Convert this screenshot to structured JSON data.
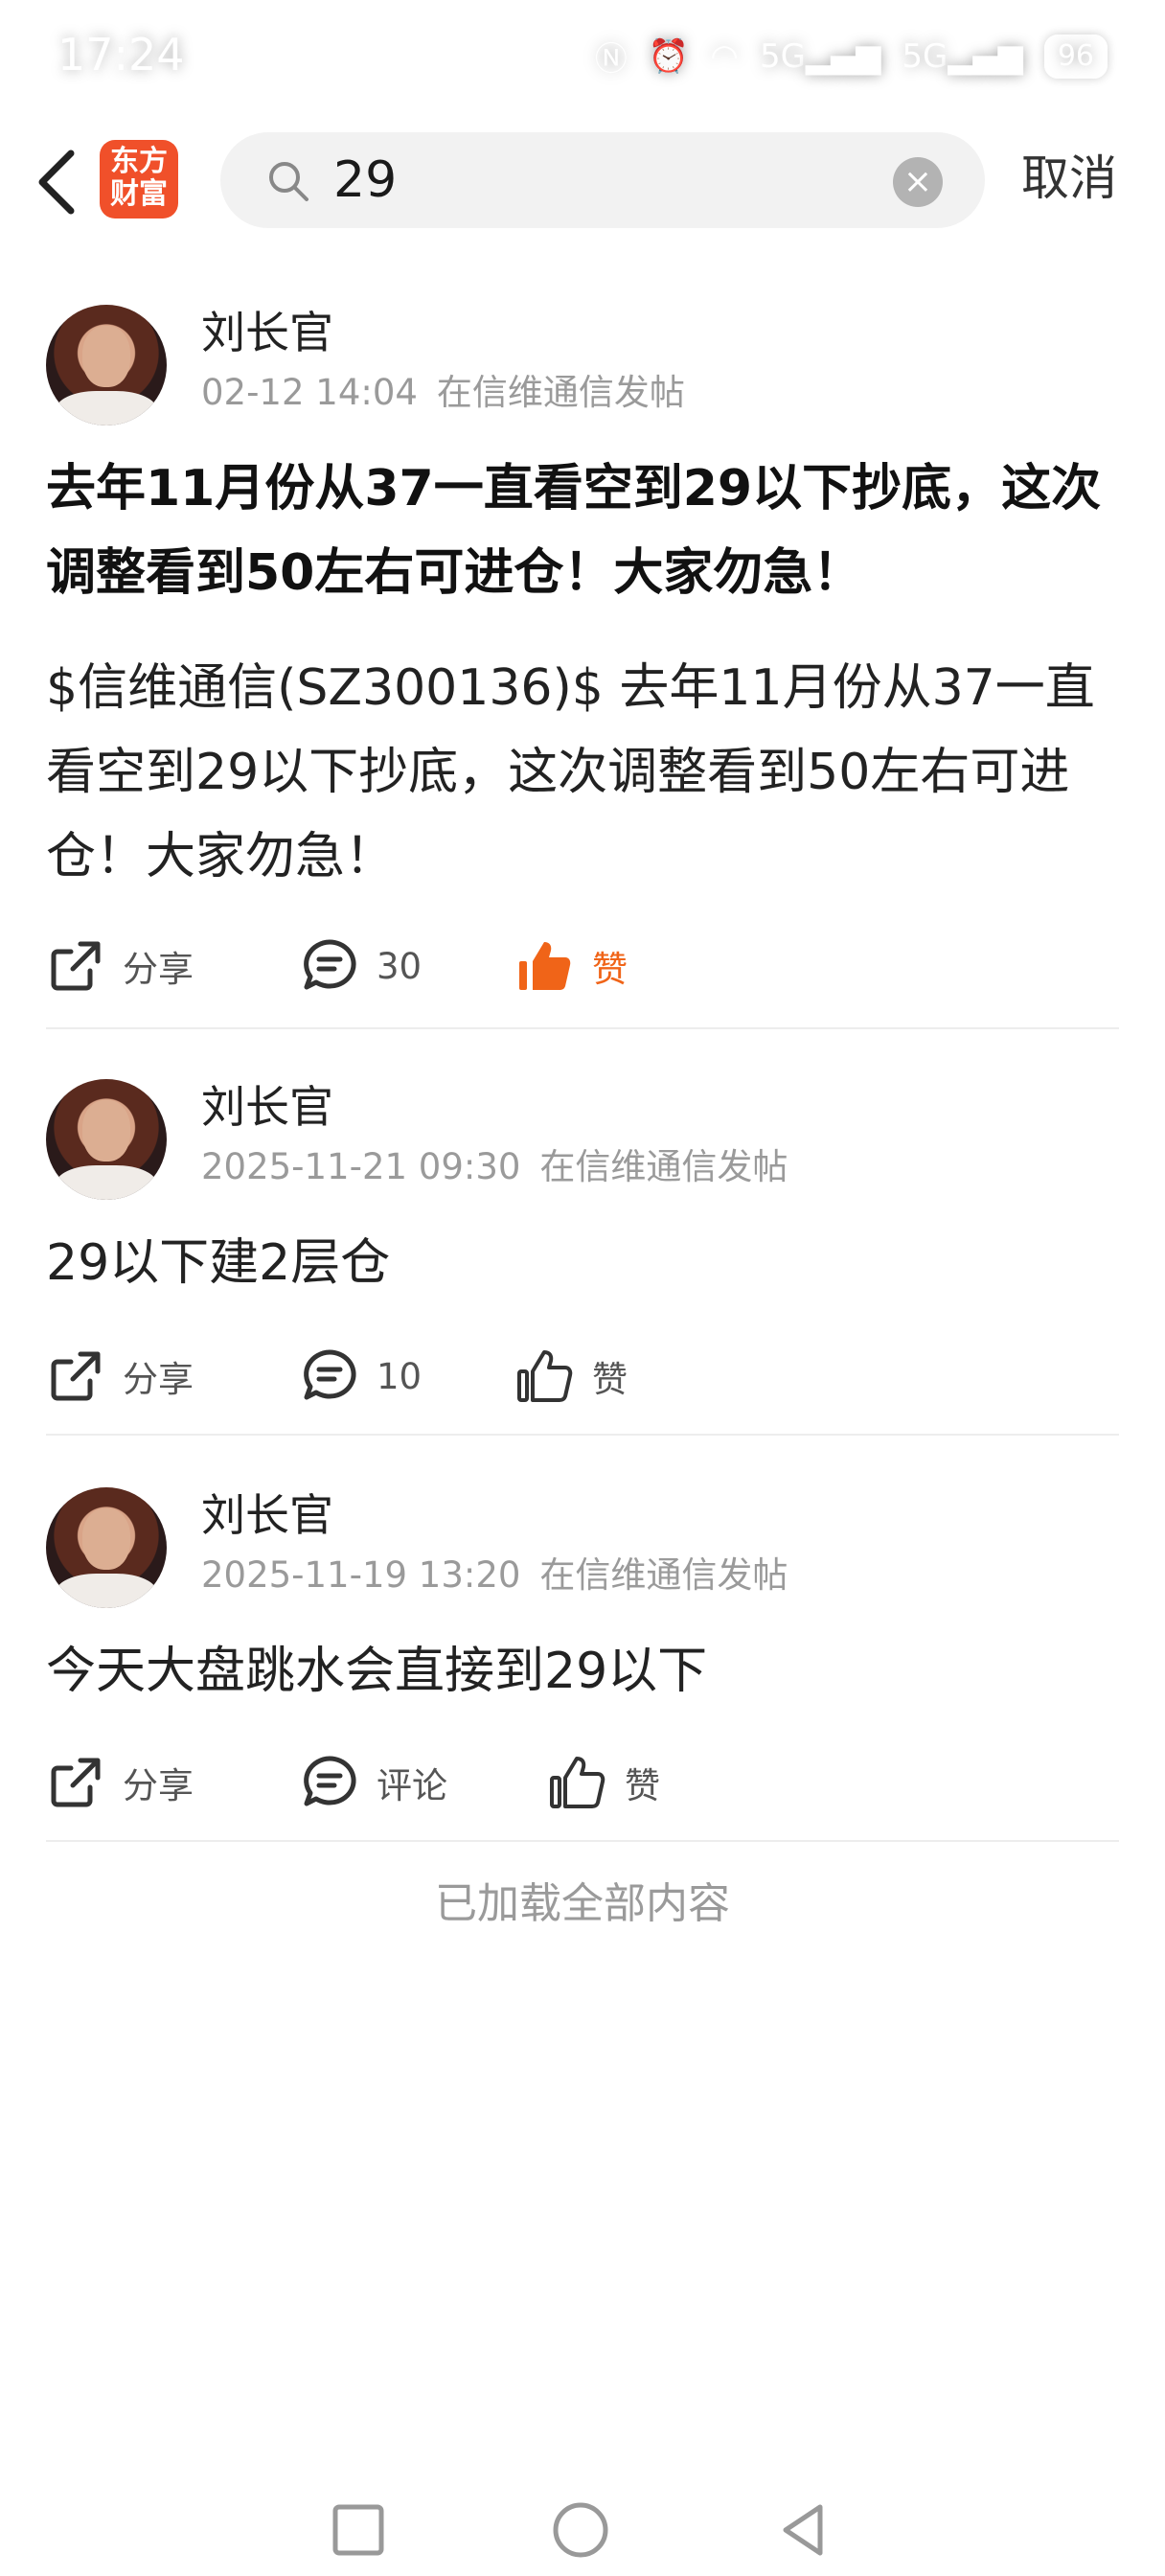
{
  "status_bar": {
    "time": "17:24",
    "signal1": "5G",
    "signal2": "5G",
    "battery": "96"
  },
  "header": {
    "logo_line1": "东方",
    "logo_line2": "财富",
    "search_query": "29",
    "cancel_label": "取消"
  },
  "posts": [
    {
      "author": "刘长官",
      "date": "02-12 14:04",
      "source": "在信维通信发帖",
      "title": "去年11月份从37一直看空到29以下抄底，这次调整看到50左右可进仓！大家勿急！",
      "body": "$信维通信(SZ300136)$ 去年11月份从37一直看空到29以下抄底，这次调整看到50左右可进仓！大家勿急！",
      "share_label": "分享",
      "comment_count": "30",
      "like_label": "赞",
      "liked": true
    },
    {
      "author": "刘长官",
      "date": "2025-11-21 09:30",
      "source": "在信维通信发帖",
      "body": "29以下建2层仓",
      "share_label": "分享",
      "comment_count": "10",
      "like_label": "赞",
      "liked": false
    },
    {
      "author": "刘长官",
      "date": "2025-11-19 13:20",
      "source": "在信维通信发帖",
      "body": "今天大盘跳水会直接到29以下",
      "share_label": "分享",
      "comment_count": "评论",
      "like_label": "赞",
      "liked": false
    }
  ],
  "footer": {
    "end_text": "已加载全部内容"
  },
  "colors": {
    "accent": "#f06418",
    "logo_bg": "#f0502a",
    "muted": "#9a9a9a"
  }
}
